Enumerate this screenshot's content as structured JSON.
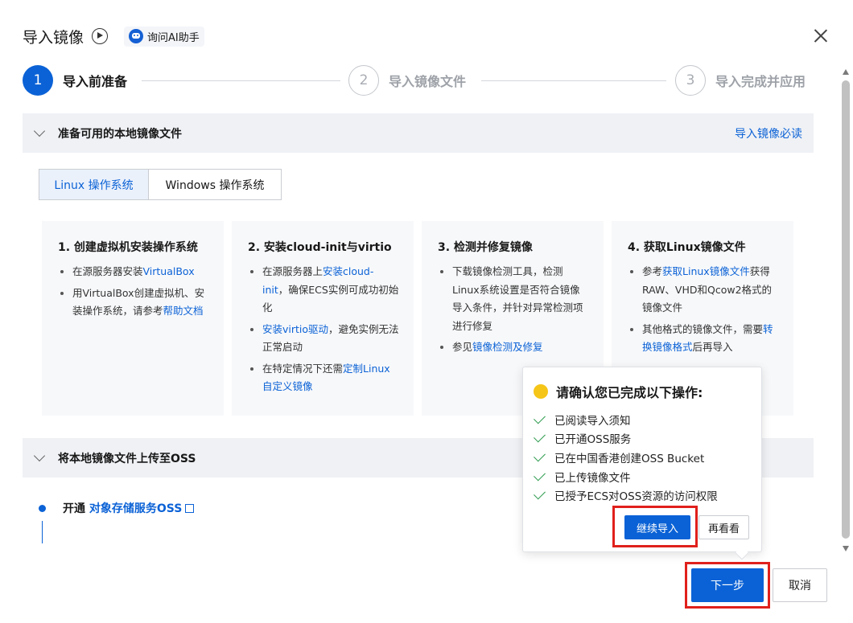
{
  "header": {
    "title": "导入镜像",
    "ai_label": "询问AI助手"
  },
  "steps": [
    {
      "number": "1",
      "label": "导入前准备",
      "state": "active"
    },
    {
      "number": "2",
      "label": "导入镜像文件",
      "state": "pending"
    },
    {
      "number": "3",
      "label": "导入完成并应用",
      "state": "pending"
    }
  ],
  "section1": {
    "title": "准备可用的本地镜像文件",
    "link": "导入镜像必读"
  },
  "os_tabs": {
    "linux": "Linux 操作系统",
    "windows": "Windows 操作系统"
  },
  "cards": [
    {
      "title": "1. 创建虚拟机安装操作系统",
      "b1_text": "在源服务器安装",
      "b1_link": "VirtualBox",
      "b2_text": "用VirtualBox创建虚拟机、安装操作系统，请参考",
      "b2_link": "帮助文档"
    },
    {
      "title": "2. 安装cloud-init与virtio",
      "b1_text": "在源服务器上",
      "b1_link": "安装cloud-init",
      "b1_tail": "，确保ECS实例可成功初始化",
      "b2_link": "安装virtio驱动",
      "b2_tail": "，避免实例无法正常启动",
      "b3_text": "在特定情况下还需",
      "b3_link": "定制Linux自定义镜像"
    },
    {
      "title": "3. 检测并修复镜像",
      "b1_text": "下载镜像检测工具，检测Linux系统设置是否符合镜像导入条件，并针对异常检测项进行修复",
      "b2_text": "参见",
      "b2_link": "镜像检测及修复"
    },
    {
      "title": "4. 获取Linux镜像文件",
      "b1_text": "参考",
      "b1_link": "获取Linux镜像文件",
      "b1_tail": "获得RAW、VHD和Qcow2格式的镜像文件",
      "b2_text": "其他格式的镜像文件，需要",
      "b2_link": "转换镜像格式",
      "b2_tail": "后再导入"
    }
  ],
  "section2": {
    "title": "将本地镜像文件上传至OSS"
  },
  "upload": {
    "prefix": "开通 ",
    "link": "对象存储服务OSS"
  },
  "popover": {
    "title": "请确认您已完成以下操作:",
    "items": [
      "已阅读导入须知",
      "已开通OSS服务",
      "已在中国香港创建OSS Bucket",
      "已上传镜像文件",
      "已授予ECS对OSS资源的访问权限"
    ],
    "continue": "继续导入",
    "again": "再看看"
  },
  "footer": {
    "next": "下一步",
    "cancel": "取消"
  },
  "colors": {
    "primary": "#0b62d6",
    "highlight": "#e0201c",
    "warning": "#f5c518",
    "check": "#2b9a4c"
  }
}
